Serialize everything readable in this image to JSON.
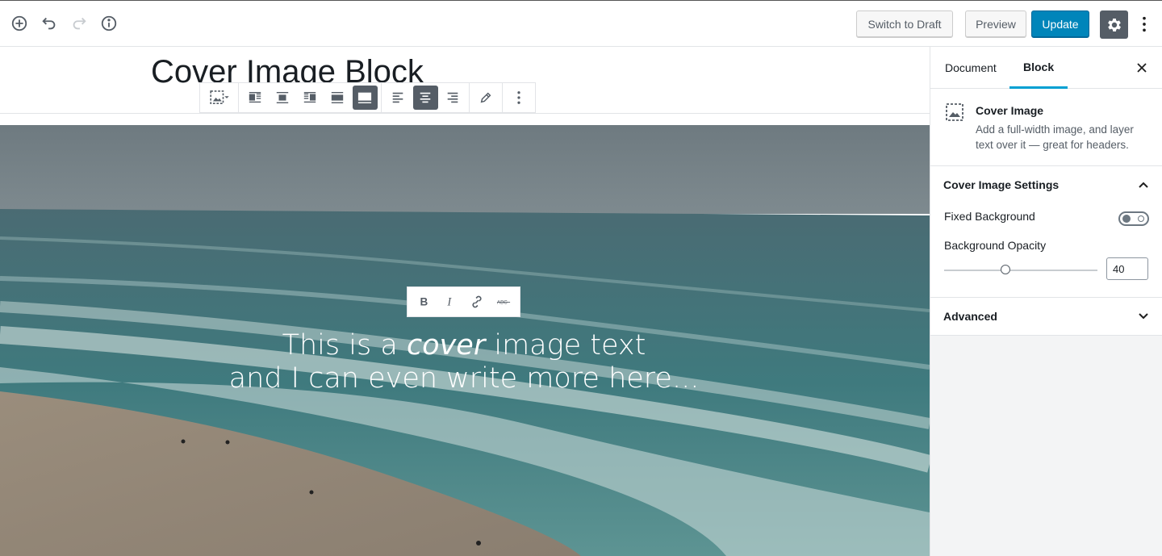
{
  "toolbar": {
    "switch_to_draft": "Switch to Draft",
    "preview": "Preview",
    "update": "Update"
  },
  "editor": {
    "title": "Cover Image Block",
    "cover_text_line1_a": "This is a ",
    "cover_text_line1_em": "cover",
    "cover_text_line1_b": " image text",
    "cover_text_line2": "and I can even write more here..."
  },
  "sidebar": {
    "tabs": [
      "Document",
      "Block"
    ],
    "active_tab": "Block",
    "block": {
      "name": "Cover Image",
      "description": "Add a full-width image, and layer text over it — great for headers."
    },
    "settings_panel": {
      "title": "Cover Image Settings",
      "fixed_background_label": "Fixed Background",
      "fixed_background_on": false,
      "opacity_label": "Background Opacity",
      "opacity_value": "40",
      "opacity_range": [
        0,
        100
      ]
    },
    "advanced_panel": {
      "title": "Advanced"
    }
  },
  "colors": {
    "primary": "#0085ba",
    "tab_accent": "#00a0d2",
    "dark_button": "#555d66"
  }
}
